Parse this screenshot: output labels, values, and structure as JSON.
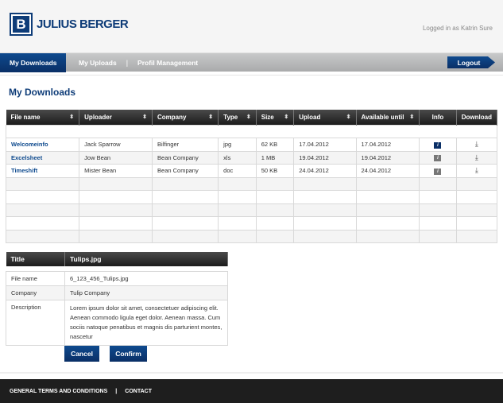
{
  "header": {
    "logo_letter": "B",
    "logo_text": "JULIUS BERGER",
    "logged_in": "Logged in as Katrin Sure"
  },
  "nav": {
    "active": "My Downloads",
    "items": [
      "My Uploads",
      "Profil Management"
    ],
    "separator": "|",
    "logout": "Logout"
  },
  "page_title": "My Downloads",
  "table": {
    "columns": [
      "File name",
      "Uploader",
      "Company",
      "Type",
      "Size",
      "Upload",
      "Available until",
      "Info",
      "Download"
    ],
    "sort_icon": "⬍",
    "rows": [
      {
        "file": "Welcomeinfo",
        "uploader": "Jack Sparrow",
        "company": "Bilfinger",
        "type": "jpg",
        "size": "62 KB",
        "upload": "17.04.2012",
        "until": "17.04.2012",
        "info": "i",
        "download": "⤓"
      },
      {
        "file": "Excelsheet",
        "uploader": "Jow Bean",
        "company": "Bean Company",
        "type": "xls",
        "size": "1 MB",
        "upload": "19.04.2012",
        "until": "19.04.2012",
        "info": "i",
        "download": "⤓"
      },
      {
        "file": "Timeshift",
        "uploader": "Mister Bean",
        "company": "Bean Company",
        "type": "doc",
        "size": "50 KB",
        "upload": "24.04.2012",
        "until": "24.04.2012",
        "info": "i",
        "download": "⤓"
      }
    ]
  },
  "detail": {
    "title_label": "Title",
    "title_value": "Tulips.jpg",
    "rows": [
      {
        "label": "File name",
        "value": "6_123_456_Tulips.jpg"
      },
      {
        "label": "Company",
        "value": "Tulip Company"
      },
      {
        "label": "Description",
        "value": "Lorem ipsum dolor sit amet, consectetuer adipiscing elit. Aenean commodo ligula eget dolor. Aenean massa. Cum sociis natoque penatibus et magnis dis parturient montes, nascetur"
      }
    ]
  },
  "buttons": {
    "cancel": "Cancel",
    "confirm": "Confirm"
  },
  "footer": {
    "terms": "GENERAL TERMS AND CONDITIONS",
    "separator": "|",
    "contact": "CONTACT"
  }
}
